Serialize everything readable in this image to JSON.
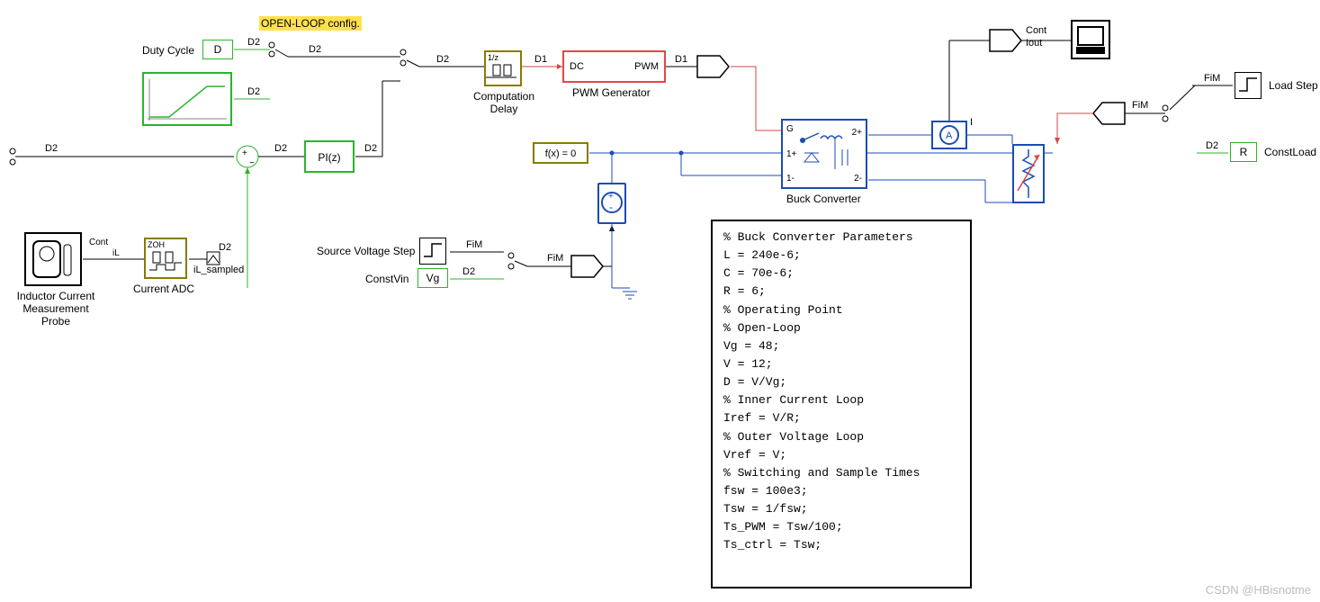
{
  "header": {
    "open_loop": "OPEN-LOOP config."
  },
  "inputs": {
    "duty_cycle_label": "Duty Cycle",
    "duty_cycle_block": "D",
    "ramp_label": "",
    "sig_D2": "D2",
    "sig_D1": "D1"
  },
  "pi": {
    "label": "PI(z)"
  },
  "comp_delay": {
    "caption": "Computation\nDelay",
    "inner": "1/z"
  },
  "pwm": {
    "caption": "PWM Generator",
    "left": "DC",
    "right": "PWM"
  },
  "fzero": {
    "text": "f(x) = 0"
  },
  "probe": {
    "caption": "Inductor Current\nMeasurement Probe",
    "IL": "IL",
    "il": "iL",
    "cont": "Cont"
  },
  "adc": {
    "caption": "Current ADC",
    "zoh": "ZOH",
    "il_sampled": "iL_sampled"
  },
  "src": {
    "step_label": "Source Voltage Step",
    "constvin_label": "ConstVin",
    "vg_block": "Vg",
    "FiM": "FiM"
  },
  "buck": {
    "caption": "Buck Converter",
    "G": "G",
    "p1": "1+",
    "m1": "1-",
    "p2": "2+",
    "m2": "2-"
  },
  "ammeter": {
    "A": "A",
    "I": "I"
  },
  "scope": {
    "cont": "Cont",
    "iout": "Iout"
  },
  "load": {
    "load_step_label": "Load Step",
    "const_load_label": "ConstLoad",
    "R": "R",
    "FiM": "FiM",
    "D2": "D2"
  },
  "code": "% Buck Converter Parameters\nL = 240e-6;\nC = 70e-6;\nR = 6;\n% Operating Point\n% Open-Loop\nVg = 48;\nV = 12;\nD = V/Vg;\n% Inner Current Loop\nIref = V/R;\n% Outer Voltage Loop\nVref = V;\n% Switching and Sample Times\nfsw = 100e3;\nTsw = 1/fsw;\nTs_PWM = Tsw/100;\nTs_ctrl = Tsw;",
  "watermark": "CSDN @HBisnotme"
}
